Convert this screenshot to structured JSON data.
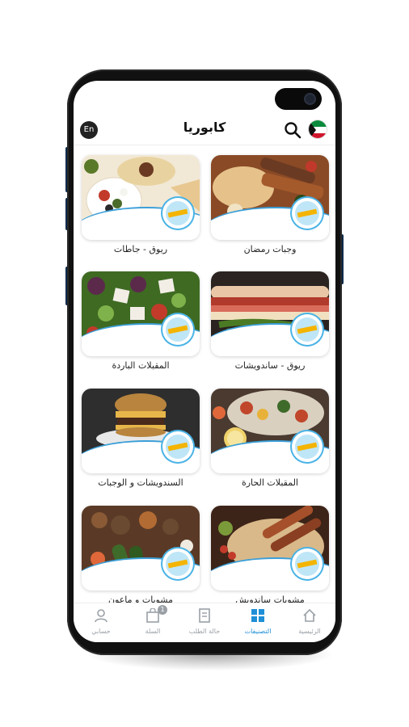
{
  "header": {
    "title": "كابوريا",
    "lang_label": "En",
    "search_icon": "search-icon",
    "flag": "kuwait-flag"
  },
  "categories": [
    {
      "label": "وجبات رمضان",
      "colors": [
        "#6b3a22",
        "#c8702f",
        "#2d4a1e"
      ]
    },
    {
      "label": "ريوق - جاطات",
      "colors": [
        "#e8d3a0",
        "#c23b2a",
        "#4b6b2a"
      ]
    },
    {
      "label": "ريوق - ساندويشات",
      "colors": [
        "#b03a2b",
        "#e9c7a6",
        "#4b7a24"
      ]
    },
    {
      "label": "المقبلات الباردة",
      "colors": [
        "#5b2a4b",
        "#7fb24a",
        "#e9e3d8"
      ]
    },
    {
      "label": "المقبلات الحارة",
      "colors": [
        "#d9d0c0",
        "#c0472b",
        "#f0d26a"
      ]
    },
    {
      "label": "السندويشات و الوجبات",
      "colors": [
        "#3a3a3a",
        "#b8843e",
        "#e6b64a"
      ]
    },
    {
      "label": "مشويات ساندويش",
      "colors": [
        "#3d2418",
        "#a5502a",
        "#7b9a3a"
      ]
    },
    {
      "label": "مشويات و ماعون",
      "colors": [
        "#6a4a30",
        "#b36b34",
        "#3f6b2a"
      ]
    }
  ],
  "badge_text": "كابوريا",
  "tabbar": {
    "items": [
      {
        "label": "الرئيسية",
        "icon": "home-icon",
        "active": false
      },
      {
        "label": "التصنيفات",
        "icon": "categories-icon",
        "active": true
      },
      {
        "label": "حالة الطلب",
        "icon": "order-status-icon",
        "active": false
      },
      {
        "label": "السلة",
        "icon": "cart-icon",
        "active": false,
        "badge": "1"
      },
      {
        "label": "حسابي",
        "icon": "account-icon",
        "active": false
      }
    ]
  },
  "colors": {
    "accent": "#1f8fd6",
    "wave": "#3b9fd8",
    "inactive": "#9aa0a6"
  }
}
